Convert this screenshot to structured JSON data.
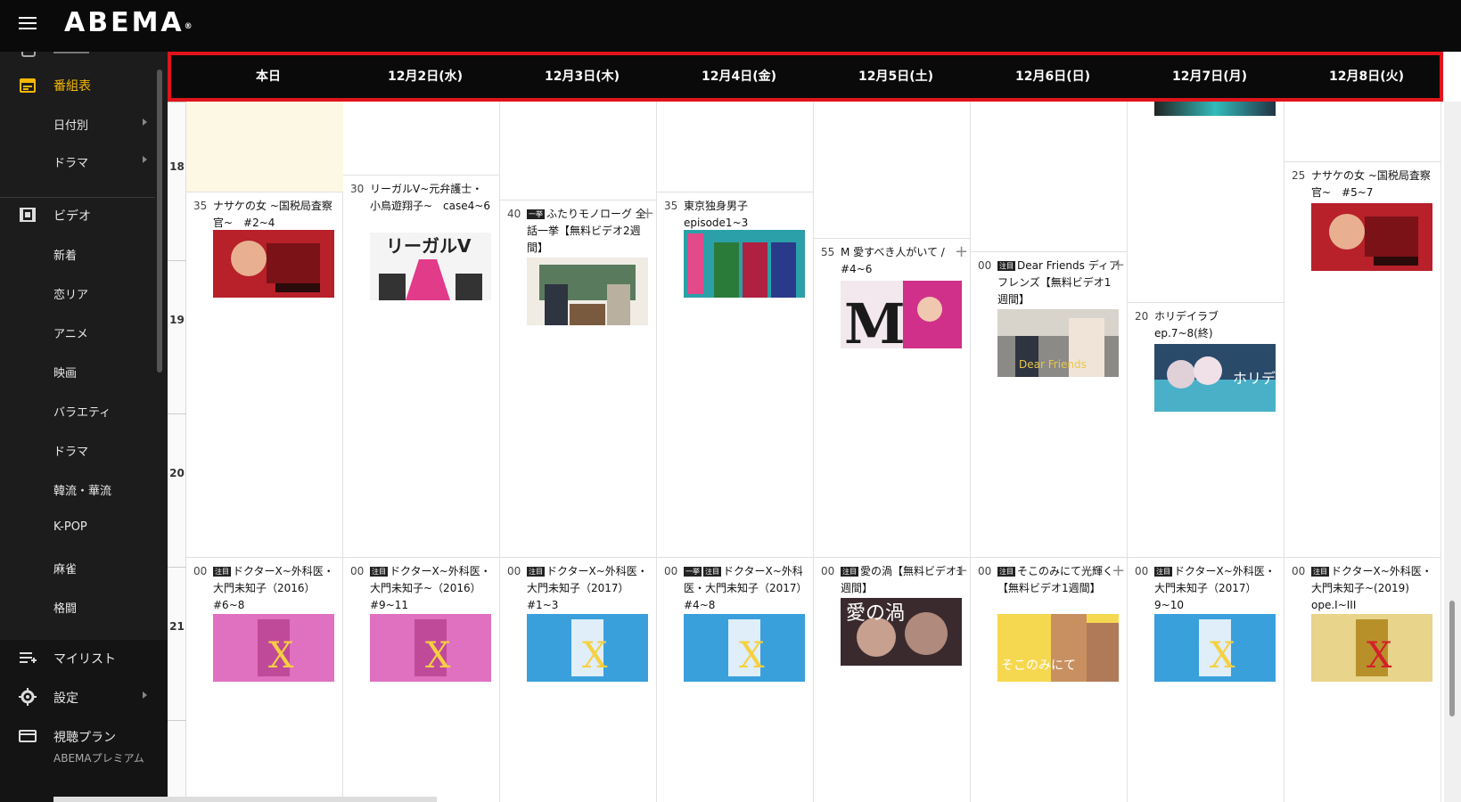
{
  "header": {
    "logo": "ABEMA",
    "logo_mark": "®"
  },
  "sidebar": {
    "guide": "番組表",
    "guide_sub": [
      "日付別",
      "ドラマ"
    ],
    "video": "ビデオ",
    "genres": [
      "新着",
      "恋リア",
      "アニメ",
      "映画",
      "バラエティ",
      "ドラマ",
      "韓流・華流",
      "K-POP",
      "麻雀",
      "格闘"
    ],
    "mylist": "マイリスト",
    "settings": "設定",
    "plan": "視聴プラン",
    "plan_sub": "ABEMAプレミアム"
  },
  "days": [
    "本日",
    "12月2日(水)",
    "12月3日(木)",
    "12月4日(金)",
    "12月5日(土)",
    "12月6日(日)",
    "12月7日(月)",
    "12月8日(火)"
  ],
  "hours": [
    "18",
    "19",
    "20",
    "21"
  ],
  "programs_evening": [
    {
      "min": "35",
      "title": "ナサケの女 ~国税局査察官~　#2~4",
      "tag": ""
    },
    {
      "min": "30",
      "title": "リーガルV~元弁護士・小鳥遊翔子~　case4~6",
      "tag": ""
    },
    {
      "min": "40",
      "title": "ふたりモノローグ 全話一挙【無料ビデオ2週間】",
      "tag": "一挙"
    },
    {
      "min": "35",
      "title": "東京独身男子 episode1~3",
      "tag": ""
    },
    {
      "min": "55",
      "title": "M 愛すべき人がいて / #4~6",
      "tag": ""
    },
    {
      "min": "00",
      "title": "Dear Friends ディア フレンズ【無料ビデオ1週間】",
      "tag": "注目"
    },
    {
      "min": "20",
      "title": "ホリデイラブ　ep.7~8(終)",
      "tag": ""
    },
    {
      "min": "25",
      "title": "ナサケの女 ~国税局査察官~　#5~7",
      "tag": ""
    }
  ],
  "programs_night": [
    {
      "min": "00",
      "title": "ドクターX~外科医・大門未知子（2016）#6~8",
      "tag": "注目"
    },
    {
      "min": "00",
      "title": "ドクターX~外科医・大門未知子~（2016）#9~11",
      "tag": "注目"
    },
    {
      "min": "00",
      "title": "ドクターX~外科医・大門未知子（2017）#1~3",
      "tag": "注目"
    },
    {
      "min": "00",
      "title": "ドクターX~外科医・大門未知子（2017）#4~8",
      "tag": "一挙 注目"
    },
    {
      "min": "00",
      "title": "愛の渦【無料ビデオ1週間】",
      "tag": "注目"
    },
    {
      "min": "00",
      "title": "そこのみにて光輝く【無料ビデオ1週間】",
      "tag": "注目"
    },
    {
      "min": "00",
      "title": "ドクターX~外科医・大門未知子（2017）9~10",
      "tag": "注目"
    },
    {
      "min": "00",
      "title": "ドクターX~外科医・大門未知子~(2019) ope.I~III",
      "tag": "注目"
    }
  ],
  "plus": "+",
  "colors": {
    "accent": "#f5b800",
    "highlight": "#e0141b",
    "header_bg": "#0a0a0a"
  }
}
